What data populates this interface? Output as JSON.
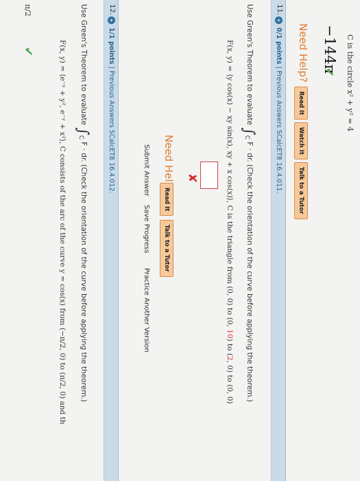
{
  "prev": {
    "curve_text": "C is the circle x² + y² = 4",
    "answer": "−144π",
    "check_icon": "check-icon",
    "need_help": "Need Help?",
    "buttons": [
      "Read It",
      "Watch It",
      "Talk to a Tutor"
    ]
  },
  "q11": {
    "number": "11.",
    "points": "0/1 points",
    "meta": "Previous Answers   SCalcET8 16.4.011.",
    "prompt_a": "Use Green's Theorem to evaluate",
    "integral_sub": "C",
    "prompt_b": "F · dr.  (Check the orientation of the curve before applying the theorem.)",
    "field_a": "F(x, y) = ⟨y cos(x) − xy sin(x), xy + x cos(x)⟩, C is the triangle from (0, 0) to (0, ",
    "field_10": "10",
    "field_b": ") to (",
    "field_2": "2",
    "field_c": ", 0) to (0, 0)",
    "cross_icon": "cross-icon",
    "need_help": "Need Help?",
    "buttons": [
      "Read It",
      "Talk to a Tutor"
    ],
    "submit": "Submit Answer",
    "save": "Save Progress",
    "practice": "Practice Another Version"
  },
  "q12": {
    "number": "12.",
    "points": "1/1 points",
    "meta": "Previous Answers   SCalcET8 16.4.012.",
    "prompt_a": "Use Green's Theorem to evaluate",
    "integral_sub": "C",
    "prompt_b": "F · dr.  (Check the orientation of the curve before applying the theorem.)",
    "field_a": "F(x, y) = ⟨e⁻ˣ + y², e⁻ʸ + x²⟩,  C consists of the arc of the curve  y = cos(x)  from",
    "point1": "(−π/2, 0)",
    "to": "to",
    "point2": "(π/2, 0)",
    "tail": "and th",
    "answer": "π/2",
    "check_icon": "check-icon"
  }
}
